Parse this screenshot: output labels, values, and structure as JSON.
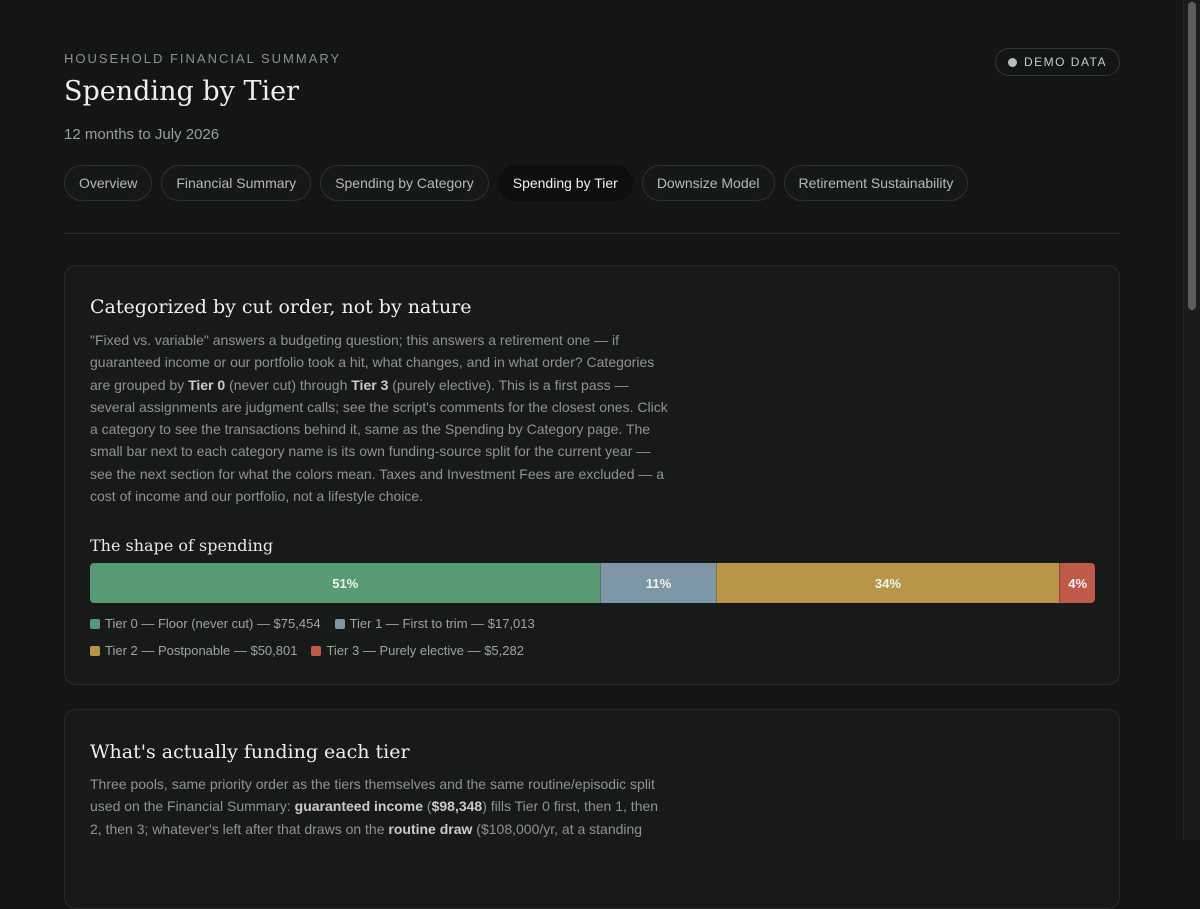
{
  "header": {
    "eyebrow": "HOUSEHOLD FINANCIAL SUMMARY",
    "title": "Spending by Tier",
    "subtitle": "12 months to July 2026",
    "badge": "DEMO DATA"
  },
  "tabs": [
    {
      "label": "Overview",
      "active": false
    },
    {
      "label": "Financial Summary",
      "active": false
    },
    {
      "label": "Spending by Category",
      "active": false
    },
    {
      "label": "Spending by Tier",
      "active": true
    },
    {
      "label": "Downsize Model",
      "active": false
    },
    {
      "label": "Retirement Sustainability",
      "active": false
    }
  ],
  "card1": {
    "title": "Categorized by cut order, not by nature",
    "body": {
      "p1": "\"Fixed vs. variable\" answers a budgeting question; this answers a retirement one — if guaranteed income or our portfolio took a hit, what changes, and in what order? Categories are grouped by ",
      "b1": "Tier 0",
      "p2": " (never cut) through ",
      "b2": "Tier 3",
      "p3": " (purely elective). This is a first pass — several assignments are judgment calls; see the script's comments for the closest ones. Click a category to see the transactions behind it, same as the Spending by Category page. The small bar next to each category name is its own funding-source split for the current year — see the next section for what the colors mean. Taxes and Investment Fees are excluded — a cost of income and our portfolio, not a lifestyle choice."
    },
    "shape_title": "The shape of spending",
    "tiers": [
      {
        "label": "Tier 0 — Floor (never cut) — $75,454",
        "amount": 75454,
        "pct_label": "51%",
        "color": "#579a73"
      },
      {
        "label": "Tier 1 — First to trim — $17,013",
        "amount": 17013,
        "pct_label": "11%",
        "color": "#7d97a6"
      },
      {
        "label": "Tier 2 — Postponable — $50,801",
        "amount": 50801,
        "pct_label": "34%",
        "color": "#b99549"
      },
      {
        "label": "Tier 3 — Purely elective — $5,282",
        "amount": 5282,
        "pct_label": "4%",
        "color": "#bf5a48"
      }
    ]
  },
  "card2": {
    "title": "What's actually funding each tier",
    "body": {
      "p1": "Three pools, same priority order as the tiers themselves and the same routine/episodic split used on the Financial Summary: ",
      "b1": "guaranteed income",
      "p2": " (",
      "b2": "$98,348",
      "p3": ") fills Tier 0 first, then 1, then 2, then 3; whatever's left after that draws on the ",
      "b3": "routine draw",
      "p4": " ($108,000/yr, at a standing"
    }
  }
}
